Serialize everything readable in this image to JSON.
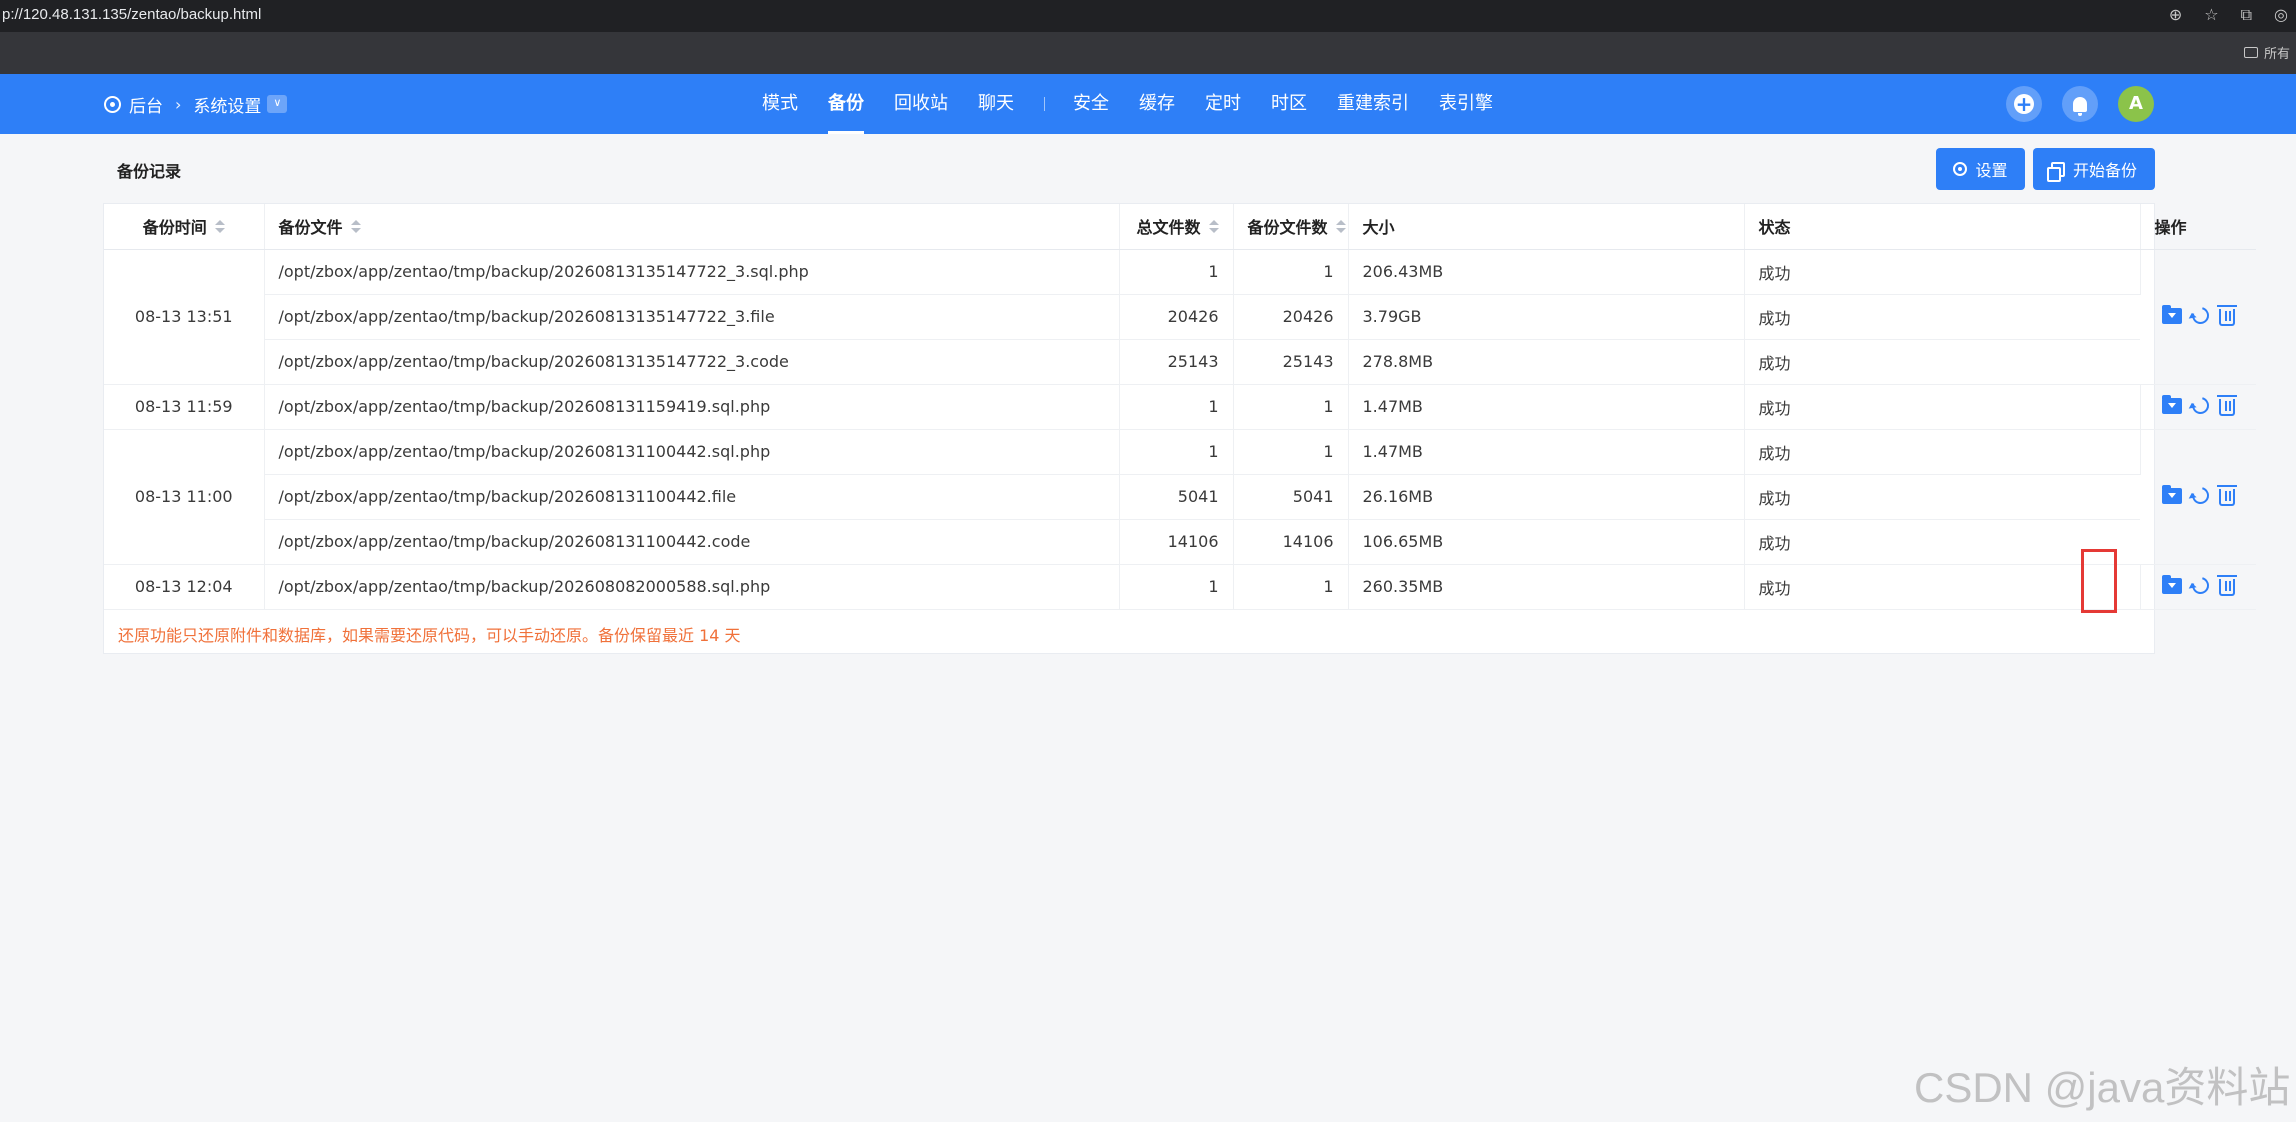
{
  "browser": {
    "url": "p://120.48.131.135/zentao/backup.html",
    "bookmark": "所有"
  },
  "nav": {
    "breadcrumb": [
      "后台",
      "系统设置"
    ],
    "tabs": [
      {
        "label": "模式",
        "active": false
      },
      {
        "label": "备份",
        "active": true
      },
      {
        "label": "回收站",
        "active": false
      },
      {
        "label": "聊天",
        "active": false
      },
      {
        "label": "安全",
        "active": false
      },
      {
        "label": "缓存",
        "active": false
      },
      {
        "label": "定时",
        "active": false
      },
      {
        "label": "时区",
        "active": false
      },
      {
        "label": "重建索引",
        "active": false
      },
      {
        "label": "表引擎",
        "active": false
      }
    ],
    "avatar": "A"
  },
  "page": {
    "title": "备份记录",
    "settings_label": "设置",
    "start_label": "开始备份"
  },
  "table": {
    "headers": [
      "备份时间",
      "备份文件",
      "总文件数",
      "备份文件数",
      "大小",
      "状态",
      "操作"
    ],
    "groups": [
      {
        "time": "08-13 13:51",
        "rows": [
          {
            "file": "/opt/zbox/app/zentao/tmp/backup/20260813135147722_3.sql.php",
            "total": "1",
            "backed": "1",
            "size": "206.43MB",
            "status": "成功"
          },
          {
            "file": "/opt/zbox/app/zentao/tmp/backup/20260813135147722_3.file",
            "total": "20426",
            "backed": "20426",
            "size": "3.79GB",
            "status": "成功"
          },
          {
            "file": "/opt/zbox/app/zentao/tmp/backup/20260813135147722_3.code",
            "total": "25143",
            "backed": "25143",
            "size": "278.8MB",
            "status": "成功"
          }
        ]
      },
      {
        "time": "08-13 11:59",
        "rows": [
          {
            "file": "/opt/zbox/app/zentao/tmp/backup/202608131159419.sql.php",
            "total": "1",
            "backed": "1",
            "size": "1.47MB",
            "status": "成功"
          }
        ]
      },
      {
        "time": "08-13 11:00",
        "rows": [
          {
            "file": "/opt/zbox/app/zentao/tmp/backup/202608131100442.sql.php",
            "total": "1",
            "backed": "1",
            "size": "1.47MB",
            "status": "成功"
          },
          {
            "file": "/opt/zbox/app/zentao/tmp/backup/202608131100442.file",
            "total": "5041",
            "backed": "5041",
            "size": "26.16MB",
            "status": "成功"
          },
          {
            "file": "/opt/zbox/app/zentao/tmp/backup/202608131100442.code",
            "total": "14106",
            "backed": "14106",
            "size": "106.65MB",
            "status": "成功"
          }
        ]
      },
      {
        "time": "08-13 12:04",
        "rows": [
          {
            "file": "/opt/zbox/app/zentao/tmp/backup/202608082000588.sql.php",
            "total": "1",
            "backed": "1",
            "size": "260.35MB",
            "status": "成功"
          }
        ]
      }
    ],
    "note": "还原功能只还原附件和数据库，如果需要还原代码，可以手动还原。备份保留最近 14 天"
  },
  "watermark": "CSDN @java资料站",
  "colors": {
    "primary": "#2e7ff7",
    "note": "#f0713a",
    "highlight": "#e53935"
  }
}
